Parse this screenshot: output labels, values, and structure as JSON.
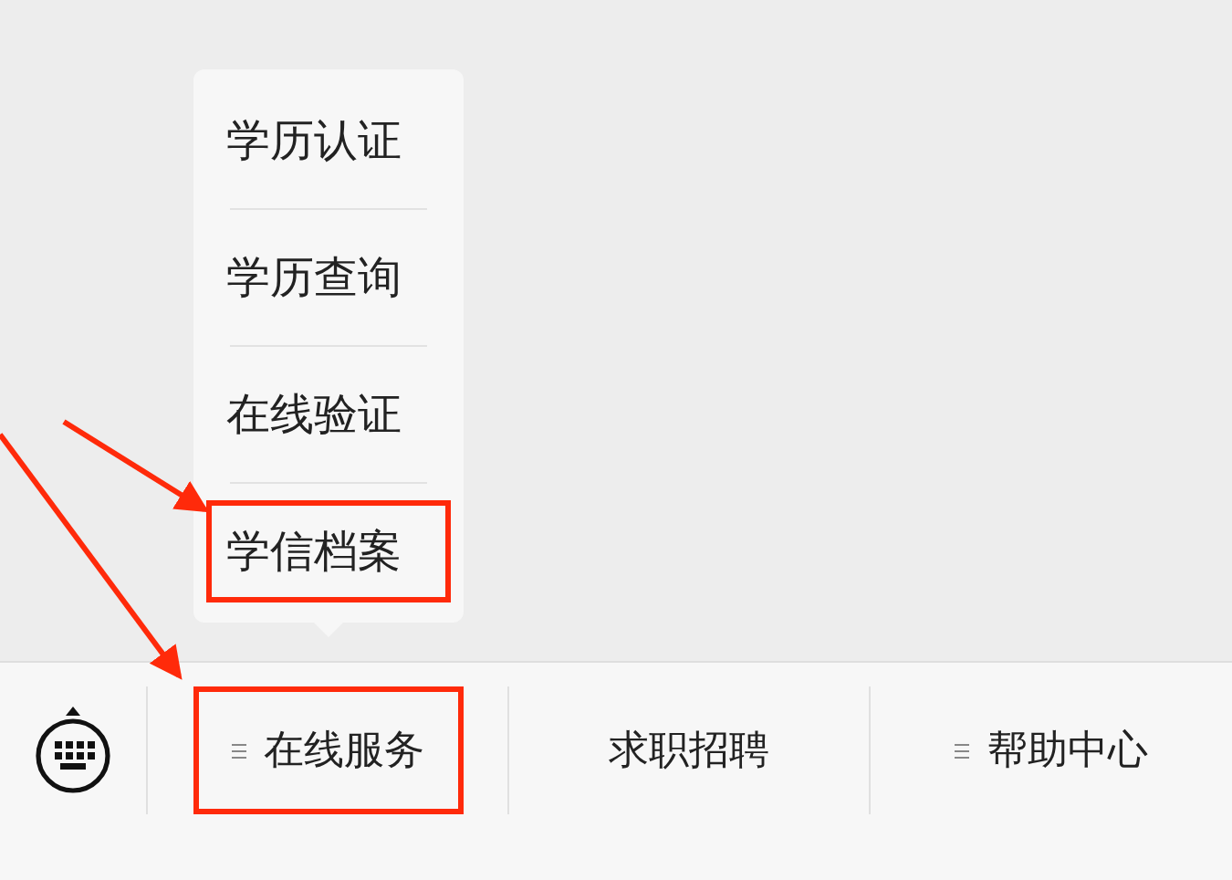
{
  "popup_menu": {
    "items": [
      {
        "label": "学历认证",
        "annotated": false
      },
      {
        "label": "学历查询",
        "annotated": false
      },
      {
        "label": "在线验证",
        "annotated": false
      },
      {
        "label": "学信档案",
        "annotated": true
      }
    ]
  },
  "bottom_menu": {
    "tabs": [
      {
        "label": "在线服务",
        "has_submenu": true,
        "annotated": true
      },
      {
        "label": "求职招聘",
        "has_submenu": false,
        "annotated": false
      },
      {
        "label": "帮助中心",
        "has_submenu": true,
        "annotated": false
      }
    ]
  }
}
